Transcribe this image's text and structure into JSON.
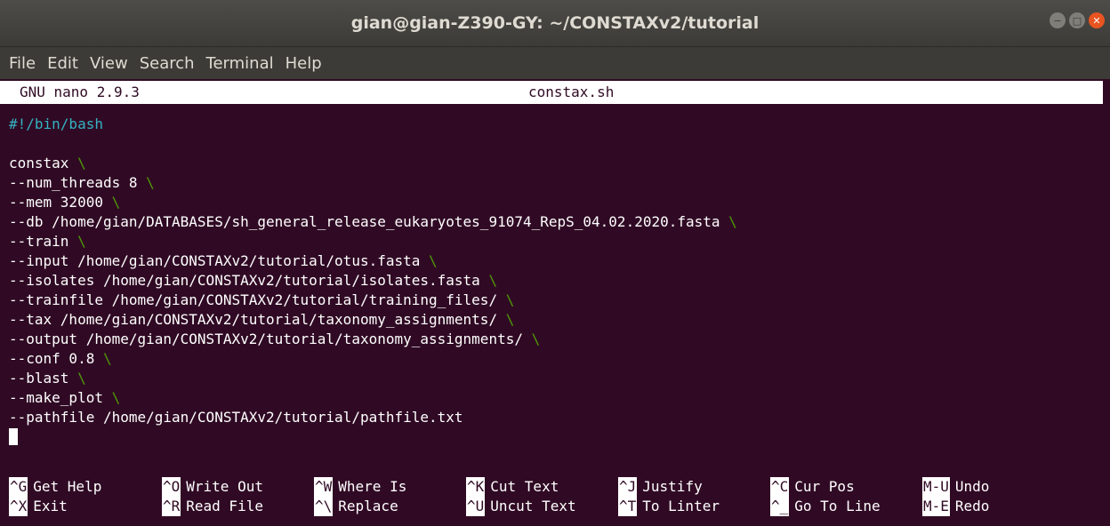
{
  "window": {
    "title": "gian@gian-Z390-GY: ~/CONSTAXv2/tutorial",
    "controls": {
      "minimize": "−",
      "maximize": "□",
      "close": "✕"
    }
  },
  "menu": [
    "File",
    "Edit",
    "View",
    "Search",
    "Terminal",
    "Help"
  ],
  "nano": {
    "version": "GNU nano 2.9.3",
    "filename": "constax.sh"
  },
  "lines": [
    {
      "text": "#!/bin/bash",
      "cont": ""
    },
    {
      "text": "",
      "cont": ""
    },
    {
      "text": "constax ",
      "cont": "\\"
    },
    {
      "text": "--num_threads 8 ",
      "cont": "\\"
    },
    {
      "text": "--mem 32000 ",
      "cont": "\\"
    },
    {
      "text": "--db /home/gian/DATABASES/sh_general_release_eukaryotes_91074_RepS_04.02.2020.fasta ",
      "cont": "\\"
    },
    {
      "text": "--train ",
      "cont": "\\"
    },
    {
      "text": "--input /home/gian/CONSTAXv2/tutorial/otus.fasta ",
      "cont": "\\"
    },
    {
      "text": "--isolates /home/gian/CONSTAXv2/tutorial/isolates.fasta ",
      "cont": "\\"
    },
    {
      "text": "--trainfile /home/gian/CONSTAXv2/tutorial/training_files/ ",
      "cont": "\\"
    },
    {
      "text": "--tax /home/gian/CONSTAXv2/tutorial/taxonomy_assignments/ ",
      "cont": "\\"
    },
    {
      "text": "--output /home/gian/CONSTAXv2/tutorial/taxonomy_assignments/ ",
      "cont": "\\"
    },
    {
      "text": "--conf 0.8 ",
      "cont": "\\"
    },
    {
      "text": "--blast ",
      "cont": "\\"
    },
    {
      "text": "--make_plot ",
      "cont": "\\"
    },
    {
      "text": "--pathfile /home/gian/CONSTAXv2/tutorial/pathfile.txt",
      "cont": ""
    }
  ],
  "shortcuts": [
    [
      {
        "key": "^G",
        "label": "Get Help"
      },
      {
        "key": "^O",
        "label": "Write Out"
      },
      {
        "key": "^W",
        "label": "Where Is"
      },
      {
        "key": "^K",
        "label": "Cut Text"
      },
      {
        "key": "^J",
        "label": "Justify"
      },
      {
        "key": "^C",
        "label": "Cur Pos"
      },
      {
        "key": "M-U",
        "label": "Undo"
      }
    ],
    [
      {
        "key": "^X",
        "label": "Exit"
      },
      {
        "key": "^R",
        "label": "Read File"
      },
      {
        "key": "^\\",
        "label": "Replace"
      },
      {
        "key": "^U",
        "label": "Uncut Text"
      },
      {
        "key": "^T",
        "label": "To Linter"
      },
      {
        "key": "^_",
        "label": "Go To Line"
      },
      {
        "key": "M-E",
        "label": "Redo"
      }
    ]
  ]
}
